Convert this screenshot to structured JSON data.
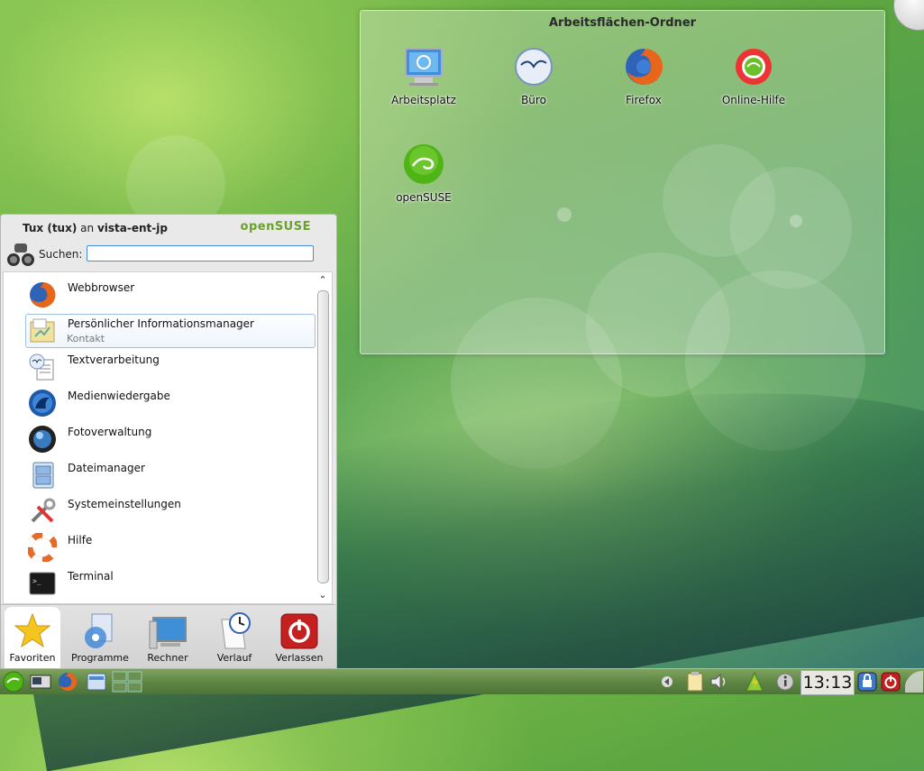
{
  "desktop": {
    "folder_title": "Arbeitsflächen-Ordner",
    "icons": [
      {
        "label": "Arbeitsplatz",
        "icon": "computer-icon"
      },
      {
        "label": "Büro",
        "icon": "office-icon"
      },
      {
        "label": "Firefox",
        "icon": "firefox-icon"
      },
      {
        "label": "Online-Hilfe",
        "icon": "online-help-icon"
      },
      {
        "label": "openSUSE",
        "icon": "opensuse-icon"
      }
    ]
  },
  "kickoff": {
    "user": "Tux (tux)",
    "user_connector": "an",
    "host": "vista-ent-jp",
    "brand": "openSUSE",
    "search_label": "Suchen:",
    "search_value": "",
    "items": [
      {
        "name": "Webbrowser",
        "desc": "",
        "icon": "firefox-icon"
      },
      {
        "name": "Persönlicher Informationsmanager",
        "desc": "Kontakt",
        "icon": "pim-icon"
      },
      {
        "name": "Textverarbeitung",
        "desc": "",
        "icon": "word-processor-icon"
      },
      {
        "name": "Medienwiedergabe",
        "desc": "",
        "icon": "media-player-icon"
      },
      {
        "name": "Fotoverwaltung",
        "desc": "",
        "icon": "photo-manager-icon"
      },
      {
        "name": "Dateimanager",
        "desc": "",
        "icon": "file-manager-icon"
      },
      {
        "name": "Systemeinstellungen",
        "desc": "",
        "icon": "settings-icon"
      },
      {
        "name": "Hilfe",
        "desc": "",
        "icon": "help-lifebuoy-icon"
      },
      {
        "name": "Terminal",
        "desc": "",
        "icon": "terminal-icon"
      }
    ],
    "tabs": [
      {
        "label": "Favoriten",
        "icon": "star-icon"
      },
      {
        "label": "Programme",
        "icon": "programs-icon"
      },
      {
        "label": "Rechner",
        "icon": "computer-icon"
      },
      {
        "label": "Verlauf",
        "icon": "clock-icon"
      },
      {
        "label": "Verlassen",
        "icon": "power-icon"
      }
    ]
  },
  "panel": {
    "clock": "13:13"
  },
  "colors": {
    "brand_green": "#6aa227",
    "selection_border": "#9fc0e6",
    "search_border": "#4a8ad6"
  }
}
